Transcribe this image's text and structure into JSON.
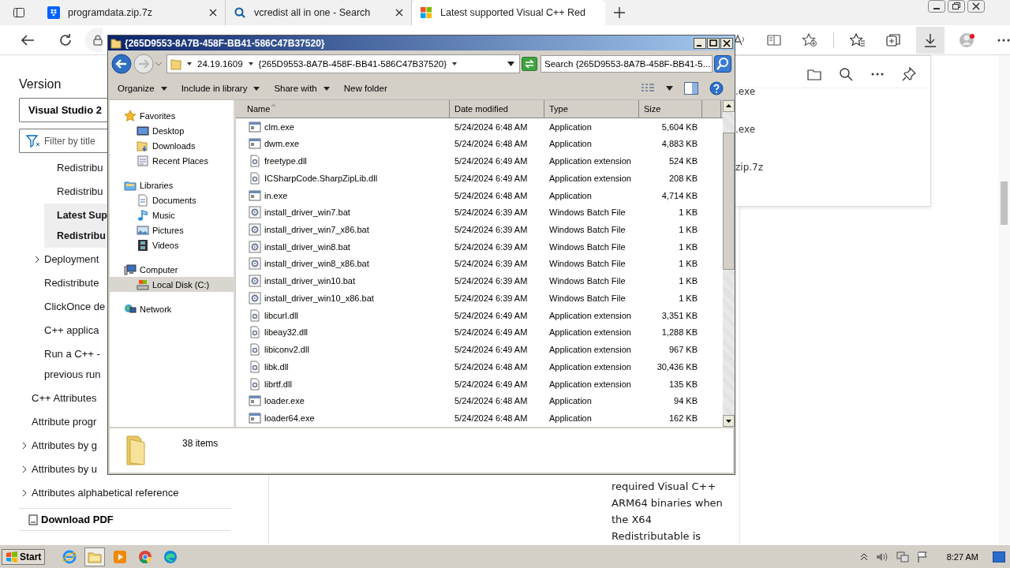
{
  "browser": {
    "tabs": [
      {
        "title": "programdata.zip.7z",
        "kind": "box",
        "selected": false
      },
      {
        "title": "vcredist all in one - Search",
        "kind": "search",
        "selected": false
      },
      {
        "title": "Latest supported Visual C++ Red",
        "kind": "windows",
        "selected": true
      }
    ],
    "toc": {
      "heading": "Version",
      "version": "Visual Studio 2",
      "filter_placeholder": "Filter by title",
      "items": [
        {
          "children": [
            {
              "children": [
                {
                  "lines": [
                    "Redistribu"
                  ],
                  "selected": false
                },
                {
                  "lines": [
                    "Redistribu"
                  ],
                  "selected": false
                },
                {
                  "lines": [
                    "Latest Sup",
                    "Redistribu"
                  ],
                  "selected": true
                }
              ]
            },
            {
              "lines": [
                "Deployment"
              ],
              "expanded": false,
              "selected": false
            },
            {
              "lines": [
                "Redistribute"
              ],
              "selected": false
            },
            {
              "lines": [
                "ClickOnce de"
              ],
              "selected": false
            },
            {
              "lines": [
                "C++ applica"
              ],
              "selected": false
            },
            {
              "lines": [
                "Run a C++ -",
                "previous run"
              ],
              "selected": false
            }
          ]
        },
        {
          "lines": [
            "C++ Attributes"
          ],
          "selected": false
        },
        {
          "lines": [
            "Attribute progr"
          ],
          "selected": false
        },
        {
          "lines": [
            "Attributes by g"
          ],
          "expanded": false,
          "selected": false
        },
        {
          "lines": [
            "Attributes by u"
          ],
          "expanded": false,
          "selected": false
        },
        {
          "lines": [
            "Attributes alphabetical reference"
          ],
          "expanded": false,
          "selected": false
        }
      ],
      "download_pdf": "Download PDF"
    },
    "article_lines": [
      "required Visual C++",
      "ARM64 binaries when",
      "the X64",
      "Redistributable is"
    ],
    "downloads": [
      ".exe",
      ".exe",
      "zip.7z"
    ]
  },
  "explorer": {
    "title": "{265D9553-8A7B-458F-BB41-586C47B37520}",
    "breadcrumb": [
      "24.19.1609",
      "{265D9553-8A7B-458F-BB41-586C47B37520}"
    ],
    "search_placeholder": "Search {265D9553-8A7B-458F-BB41-5...",
    "toolbar": [
      "Organize",
      "Include in library",
      "Share with",
      "New folder"
    ],
    "nav": [
      {
        "label": "Favorites",
        "kind": "star",
        "selected": false,
        "children": [
          {
            "label": "Desktop",
            "kind": "desktop",
            "selected": false
          },
          {
            "label": "Downloads",
            "kind": "downloads",
            "selected": false
          },
          {
            "label": "Recent Places",
            "kind": "recent",
            "selected": false
          }
        ]
      },
      {
        "label": "Libraries",
        "kind": "library",
        "selected": false,
        "children": [
          {
            "label": "Documents",
            "kind": "documents",
            "selected": false
          },
          {
            "label": "Music",
            "kind": "music",
            "selected": false
          },
          {
            "label": "Pictures",
            "kind": "pictures",
            "selected": false
          },
          {
            "label": "Videos",
            "kind": "videos",
            "selected": false
          }
        ]
      },
      {
        "label": "Computer",
        "kind": "computer",
        "selected": false,
        "children": [
          {
            "label": "Local Disk (C:)",
            "kind": "disk",
            "selected": true
          }
        ]
      },
      {
        "label": "Network",
        "kind": "network",
        "selected": false
      }
    ],
    "columns": [
      {
        "label": "Name",
        "sorted": true
      },
      {
        "label": "Date modified",
        "sorted": false
      },
      {
        "label": "Type",
        "sorted": false
      },
      {
        "label": "Size",
        "sorted": false
      }
    ],
    "files": [
      {
        "name": "clm.exe",
        "date": "5/24/2024 6:48 AM",
        "type": "Application",
        "size": "5,604 KB",
        "kind": "exe"
      },
      {
        "name": "dwm.exe",
        "date": "5/24/2024 6:48 AM",
        "type": "Application",
        "size": "4,883 KB",
        "kind": "exe"
      },
      {
        "name": "freetype.dll",
        "date": "5/24/2024 6:49 AM",
        "type": "Application extension",
        "size": "524 KB",
        "kind": "dll"
      },
      {
        "name": "ICSharpCode.SharpZipLib.dll",
        "date": "5/24/2024 6:49 AM",
        "type": "Application extension",
        "size": "208 KB",
        "kind": "dll"
      },
      {
        "name": "in.exe",
        "date": "5/24/2024 6:48 AM",
        "type": "Application",
        "size": "4,714 KB",
        "kind": "exe"
      },
      {
        "name": "install_driver_win7.bat",
        "date": "5/24/2024 6:39 AM",
        "type": "Windows Batch File",
        "size": "1 KB",
        "kind": "bat"
      },
      {
        "name": "install_driver_win7_x86.bat",
        "date": "5/24/2024 6:39 AM",
        "type": "Windows Batch File",
        "size": "1 KB",
        "kind": "bat"
      },
      {
        "name": "install_driver_win8.bat",
        "date": "5/24/2024 6:39 AM",
        "type": "Windows Batch File",
        "size": "1 KB",
        "kind": "bat"
      },
      {
        "name": "install_driver_win8_x86.bat",
        "date": "5/24/2024 6:39 AM",
        "type": "Windows Batch File",
        "size": "1 KB",
        "kind": "bat"
      },
      {
        "name": "install_driver_win10.bat",
        "date": "5/24/2024 6:39 AM",
        "type": "Windows Batch File",
        "size": "1 KB",
        "kind": "bat"
      },
      {
        "name": "install_driver_win10_x86.bat",
        "date": "5/24/2024 6:39 AM",
        "type": "Windows Batch File",
        "size": "1 KB",
        "kind": "bat"
      },
      {
        "name": "libcurl.dll",
        "date": "5/24/2024 6:49 AM",
        "type": "Application extension",
        "size": "3,351 KB",
        "kind": "dll"
      },
      {
        "name": "libeay32.dll",
        "date": "5/24/2024 6:49 AM",
        "type": "Application extension",
        "size": "1,288 KB",
        "kind": "dll"
      },
      {
        "name": "libiconv2.dll",
        "date": "5/24/2024 6:49 AM",
        "type": "Application extension",
        "size": "967 KB",
        "kind": "dll"
      },
      {
        "name": "libk.dll",
        "date": "5/24/2024 6:48 AM",
        "type": "Application extension",
        "size": "30,436 KB",
        "kind": "dll"
      },
      {
        "name": "librtf.dll",
        "date": "5/24/2024 6:49 AM",
        "type": "Application extension",
        "size": "135 KB",
        "kind": "dll"
      },
      {
        "name": "loader.exe",
        "date": "5/24/2024 6:48 AM",
        "type": "Application",
        "size": "94 KB",
        "kind": "exe"
      },
      {
        "name": "loader64.exe",
        "date": "5/24/2024 6:48 AM",
        "type": "Application",
        "size": "162 KB",
        "kind": "exe"
      }
    ],
    "status": "38 items"
  },
  "taskbar": {
    "start": "Start",
    "apps": [
      {
        "kind": "ie",
        "selected": false
      },
      {
        "kind": "folder",
        "selected": true
      },
      {
        "kind": "media",
        "selected": false
      },
      {
        "kind": "chrome",
        "selected": false
      },
      {
        "kind": "edge",
        "selected": false
      }
    ],
    "time": "8:27 AM"
  }
}
